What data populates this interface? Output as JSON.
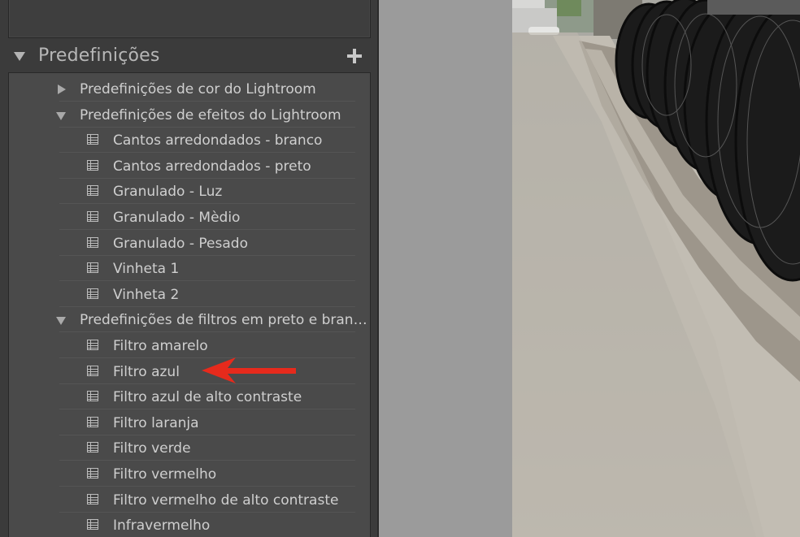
{
  "panel": {
    "title": "Predefinições",
    "add_symbol": "+"
  },
  "presets": {
    "folders": [
      {
        "label": "Predefinições de cor do Lightroom",
        "expanded": false,
        "items": []
      },
      {
        "label": "Predefinições de efeitos do Lightroom",
        "expanded": true,
        "items": [
          "Cantos arredondados - branco",
          "Cantos arredondados - preto",
          "Granulado - Luz",
          "Granulado - Mèdio",
          "Granulado - Pesado",
          "Vinheta 1",
          "Vinheta 2"
        ]
      },
      {
        "label": "Predefinições de filtros em preto e bran…",
        "expanded": true,
        "items": [
          "Filtro amarelo",
          "Filtro azul",
          "Filtro azul de alto contraste",
          "Filtro laranja",
          "Filtro verde",
          "Filtro vermelho",
          "Filtro vermelho de alto contraste",
          "Infravermelho"
        ]
      }
    ]
  },
  "icons": {
    "collapsed": "triangle-right-icon",
    "expanded": "triangle-down-icon",
    "preset": "preset-list-icon",
    "add": "plus-icon",
    "annotation": "red-arrow-icon"
  },
  "colors": {
    "panel_bg": "#3b3b3b",
    "list_bg": "#4a4a4a",
    "text": "#cfcfcf",
    "annotation_arrow": "#e62a1c"
  },
  "annotation": {
    "points_to": "Filtro azul"
  }
}
